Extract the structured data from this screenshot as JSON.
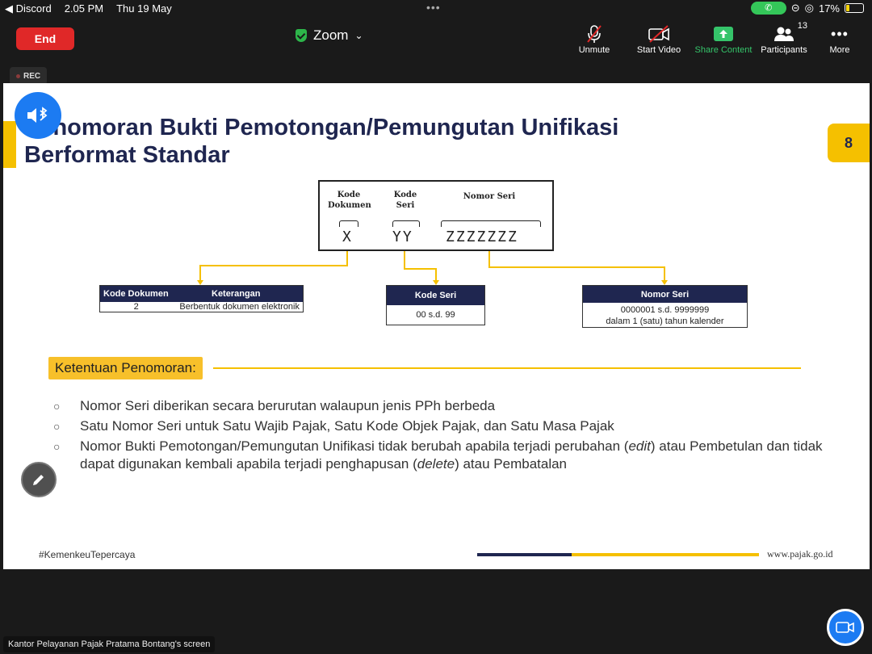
{
  "status_bar": {
    "back_app": "◀ Discord",
    "time": "2.05 PM",
    "date": "Thu 19 May",
    "battery": "17%"
  },
  "toolbar": {
    "end_label": "End",
    "meeting_title": "Zoom",
    "unmute_label": "Unmute",
    "start_video_label": "Start Video",
    "share_content_label": "Share Content",
    "participants_label": "Participants",
    "participants_count": "13",
    "more_label": "More"
  },
  "rec_label": "REC",
  "slide": {
    "title_line1": "Penomoran Bukti Pemotongan/Pemungutan Unifikasi",
    "title_line2": "Berformat Standar",
    "page_number": "8",
    "format": {
      "label_kode_dokumen": "Kode\nDokumen",
      "label_kode_seri": "Kode\nSeri",
      "label_nomor_seri": "Nomor Seri",
      "code_x": "X",
      "code_yy": "YY",
      "code_z": "ZZZZZZZ"
    },
    "table_kode_dokumen": {
      "col1": "Kode Dokumen",
      "col2": "Keterangan",
      "val1": "2",
      "val2": "Berbentuk dokumen elektronik"
    },
    "table_kode_seri": {
      "header": "Kode Seri",
      "value": "00 s.d. 99"
    },
    "table_nomor_seri": {
      "header": "Nomor Seri",
      "line1": "0000001 s.d. 9999999",
      "line2": "dalam 1 (satu) tahun kalender"
    },
    "ketentuan_label": "Ketentuan Penomoran:",
    "bullets": {
      "b1": "Nomor Seri diberikan secara berurutan walaupun jenis PPh berbeda",
      "b2": "Satu Nomor Seri untuk Satu Wajib Pajak, Satu Kode Objek Pajak, dan Satu Masa Pajak",
      "b3_part1": "Nomor Bukti Pemotongan/Pemungutan Unifikasi tidak berubah apabila terjadi perubahan (",
      "b3_edit": "edit",
      "b3_part2": ") atau Pembetulan dan tidak dapat digunakan kembali apabila terjadi penghapusan (",
      "b3_delete": "delete",
      "b3_part3": ") atau Pembatalan"
    },
    "footer_hashtag": "#KemenkeuTepercaya",
    "footer_url": "www.pajak.go.id"
  },
  "screen_share_label": "Kantor Pelayanan Pajak Pratama Bontang's screen",
  "colors": {
    "navy": "#1f2650",
    "yellow": "#f5c000",
    "end_red": "#e02828",
    "share_green": "#35c46a",
    "zoom_blue": "#1c7bf2"
  }
}
